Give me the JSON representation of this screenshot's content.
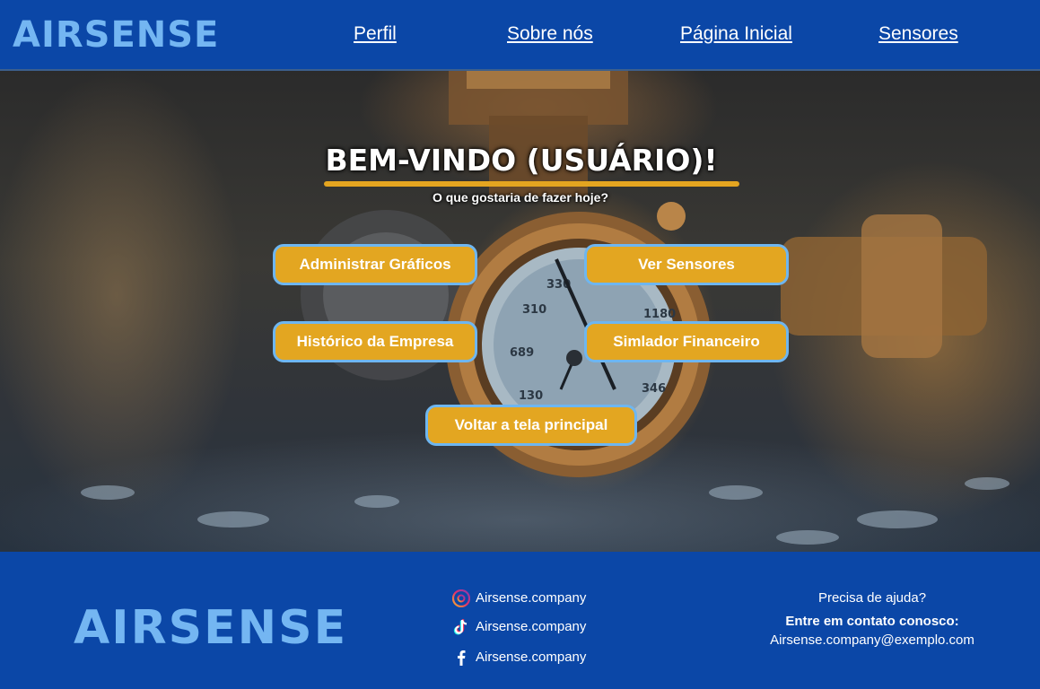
{
  "header": {
    "logo": "AIRSENSE",
    "nav": [
      "Perfil",
      "Sobre nós",
      "Página Inicial",
      "Sensores"
    ]
  },
  "hero": {
    "title": "BEM-VINDO (USUÁRIO)!",
    "subtitle": "O que gostaria de fazer hoje?",
    "buttons": {
      "admin_graficos": "Administrar Gráficos",
      "ver_sensores": "Ver Sensores",
      "historico": "Histórico da Empresa",
      "simulador": "Simlador Financeiro",
      "voltar": "Voltar a tela principal"
    },
    "gauge_ticks": [
      "330",
      "310",
      "1180",
      "689",
      "130",
      "346"
    ]
  },
  "footer": {
    "logo": "AIRSENSE",
    "social": [
      {
        "icon": "threads-icon",
        "label": "Airsense.company"
      },
      {
        "icon": "tiktok-icon",
        "label": "Airsense.company"
      },
      {
        "icon": "facebook-icon",
        "label": "Airsense.company"
      }
    ],
    "help": {
      "question": "Precisa de ajuda?",
      "contact": "Entre em contato conosco:",
      "email": "Airsense.company@exemplo.com"
    }
  },
  "colors": {
    "primary_blue": "#0b47a7",
    "logo_blue": "#74b6f2",
    "button_gold": "#e3a621",
    "button_border": "#6eb6f0"
  }
}
